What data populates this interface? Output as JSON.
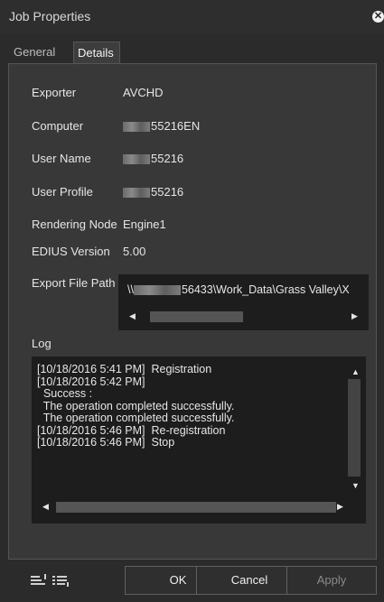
{
  "window": {
    "title": "Job Properties",
    "close_glyph": "✕"
  },
  "tabs": [
    {
      "label": "General",
      "selected": false
    },
    {
      "label": "Details",
      "selected": true
    }
  ],
  "details": {
    "exporter": {
      "label": "Exporter",
      "value": "AVCHD"
    },
    "computer": {
      "label": "Computer",
      "value": "55216EN"
    },
    "user_name": {
      "label": "User Name",
      "value": "55216"
    },
    "user_profile": {
      "label": "User Profile",
      "value": "55216"
    },
    "rendering_node": {
      "label": "Rendering Node",
      "value": "Engine1"
    },
    "edius_version": {
      "label": "EDIUS Version",
      "value": "5.00"
    },
    "export_file_path": {
      "label": "Export File Path",
      "prefix": "\\\\",
      "value": "56433\\Work_Data\\Grass Valley\\X"
    }
  },
  "log": {
    "label": "Log",
    "text": "[10/18/2016 5:41 PM]  Registration\n[10/18/2016 5:42 PM]\n  Success :\n  The operation completed successfully.\n  The operation completed successfully.\n[10/18/2016 5:46 PM]  Re-registration\n[10/18/2016 5:46 PM]  Stop"
  },
  "buttons": {
    "ok": "OK",
    "cancel": "Cancel",
    "apply": "Apply"
  },
  "icons": {
    "close": "close-icon",
    "list_up": "list-upload-icon",
    "list_down": "list-download-icon"
  }
}
